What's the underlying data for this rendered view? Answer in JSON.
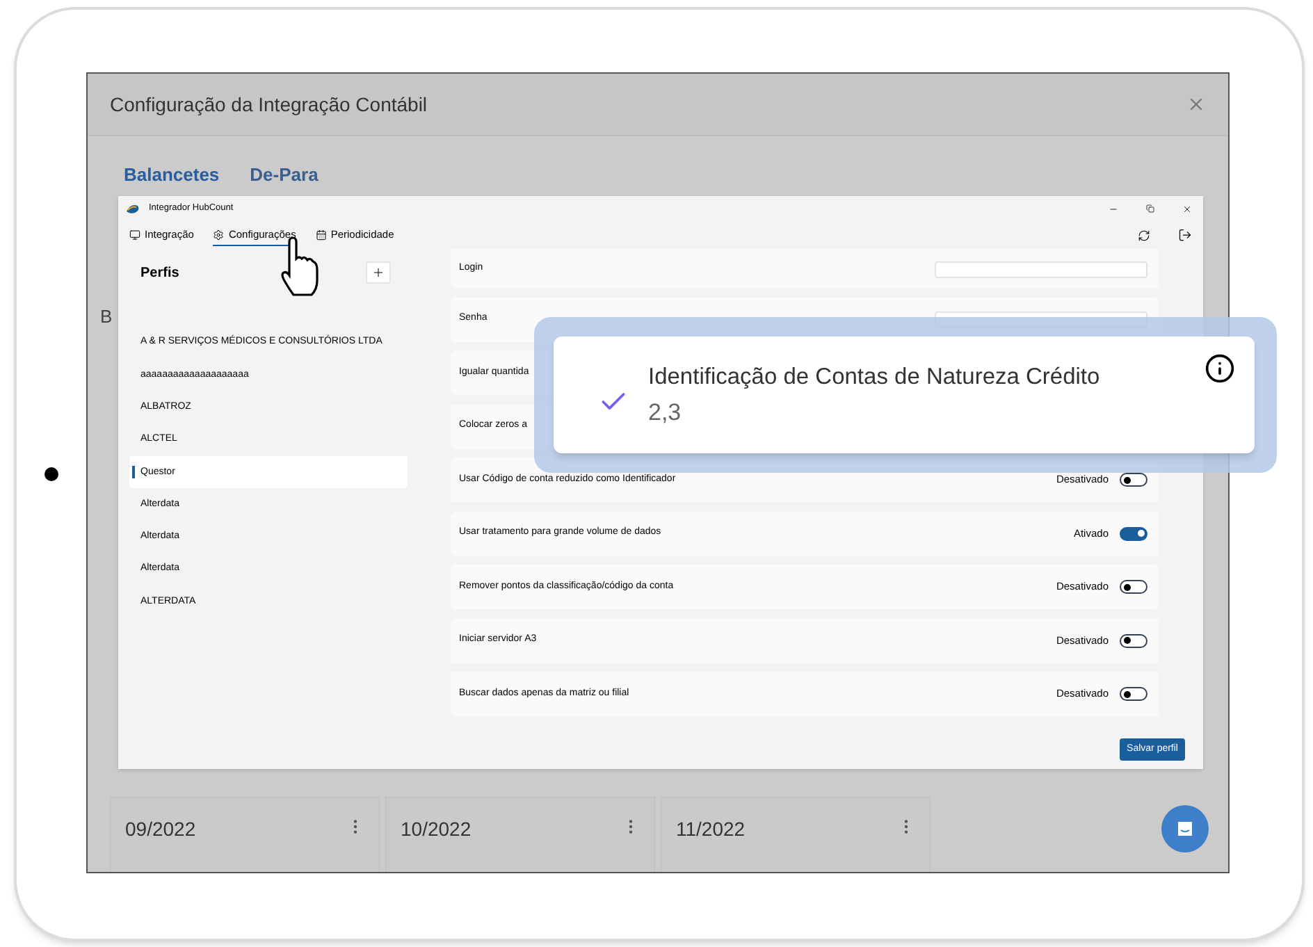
{
  "modal": {
    "title": "Configuração da Integração Contábil",
    "tabs": [
      {
        "label": "Balancetes",
        "selected": true
      },
      {
        "label": "De-Para",
        "selected": false
      }
    ],
    "heading_fragment": "B",
    "periods": [
      {
        "label": "09/2022"
      },
      {
        "label": "10/2022"
      },
      {
        "label": "11/2022"
      }
    ]
  },
  "app_window": {
    "title": "Integrador HubCount",
    "nav": [
      {
        "label": "Integração",
        "selected": false
      },
      {
        "label": "Configurações",
        "selected": true
      },
      {
        "label": "Periodicidade",
        "selected": false
      }
    ],
    "profiles": {
      "title": "Perfis",
      "items": [
        {
          "name": "A & R SERVIÇOS MÉDICOS E CONSULTÓRIOS LTDA",
          "selected": false
        },
        {
          "name": "aaaaaaaaaaaaaaaaaaaa",
          "selected": false
        },
        {
          "name": "ALBATROZ",
          "selected": false
        },
        {
          "name": "ALCTEL",
          "selected": false
        },
        {
          "name": "Questor",
          "selected": true
        },
        {
          "name": "Alterdata",
          "selected": false
        },
        {
          "name": "Alterdata",
          "selected": false
        },
        {
          "name": "Alterdata",
          "selected": false
        },
        {
          "name": "ALTERDATA",
          "selected": false
        }
      ]
    },
    "settings": [
      {
        "kind": "field",
        "label": "Login"
      },
      {
        "kind": "field",
        "label": "Senha"
      },
      {
        "kind": "text",
        "label": "Igualar quantida"
      },
      {
        "kind": "text",
        "label": "Colocar zeros a"
      },
      {
        "kind": "toggle",
        "label": "Usar Código de conta reduzido como Identificador",
        "status": "Desativado",
        "on": false
      },
      {
        "kind": "toggle",
        "label": "Usar tratamento para grande volume de dados",
        "status": "Ativado",
        "on": true
      },
      {
        "kind": "toggle",
        "label": "Remover pontos da classificação/código da conta",
        "status": "Desativado",
        "on": false
      },
      {
        "kind": "toggle",
        "label": "Iniciar servidor A3",
        "status": "Desativado",
        "on": false
      },
      {
        "kind": "toggle",
        "label": "Buscar dados apenas da matriz ou filial",
        "status": "Desativado",
        "on": false
      }
    ],
    "save_button": "Salvar perfil"
  },
  "toast": {
    "title": "Identificação de Contas de Natureza Crédito",
    "value": "2,3"
  }
}
